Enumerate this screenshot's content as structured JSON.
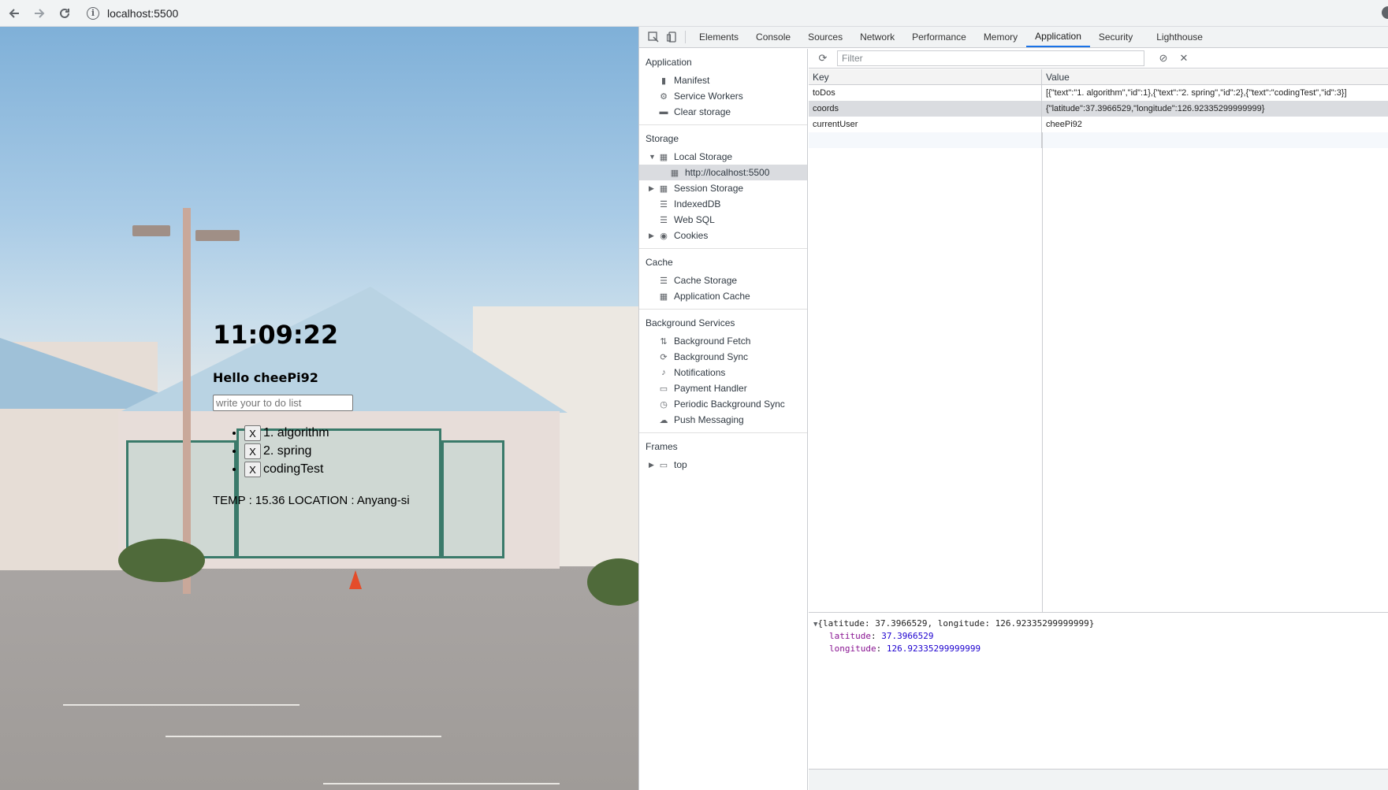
{
  "browser": {
    "url": "localhost:5500"
  },
  "page": {
    "clock": "11:09:22",
    "greeting": "Hello cheePi92",
    "todo_placeholder": "write your to do list",
    "todos": [
      {
        "delete_label": "X",
        "text": "1. algorithm"
      },
      {
        "delete_label": "X",
        "text": "2. spring"
      },
      {
        "delete_label": "X",
        "text": "codingTest"
      }
    ],
    "weather": "TEMP : 15.36 LOCATION : Anyang-si"
  },
  "devtools": {
    "tabs": [
      "Elements",
      "Console",
      "Sources",
      "Network",
      "Performance",
      "Memory",
      "Application",
      "Security",
      "Lighthouse"
    ],
    "active_tab": "Application",
    "sidebar": {
      "application": {
        "title": "Application",
        "items": [
          "Manifest",
          "Service Workers",
          "Clear storage"
        ]
      },
      "storage": {
        "title": "Storage",
        "local_storage": "Local Storage",
        "local_storage_origin": "http://localhost:5500",
        "session_storage": "Session Storage",
        "indexeddb": "IndexedDB",
        "websql": "Web SQL",
        "cookies": "Cookies"
      },
      "cache": {
        "title": "Cache",
        "items": [
          "Cache Storage",
          "Application Cache"
        ]
      },
      "background": {
        "title": "Background Services",
        "items": [
          "Background Fetch",
          "Background Sync",
          "Notifications",
          "Payment Handler",
          "Periodic Background Sync",
          "Push Messaging"
        ]
      },
      "frames": {
        "title": "Frames",
        "top": "top"
      }
    },
    "filter_placeholder": "Filter",
    "table": {
      "key_header": "Key",
      "value_header": "Value",
      "rows": [
        {
          "key": "toDos",
          "value": "[{\"text\":\"1. algorithm\",\"id\":1},{\"text\":\"2. spring\",\"id\":2},{\"text\":\"codingTest\",\"id\":3}]"
        },
        {
          "key": "coords",
          "value": "{\"latitude\":37.3966529,\"longitude\":126.92335299999999}"
        },
        {
          "key": "currentUser",
          "value": "cheePi92"
        }
      ]
    },
    "preview": {
      "summary": "{latitude: 37.3966529, longitude: 126.92335299999999}",
      "lat_name": "latitude",
      "lat_value": "37.3966529",
      "lon_name": "longitude",
      "lon_value": "126.92335299999999"
    }
  }
}
